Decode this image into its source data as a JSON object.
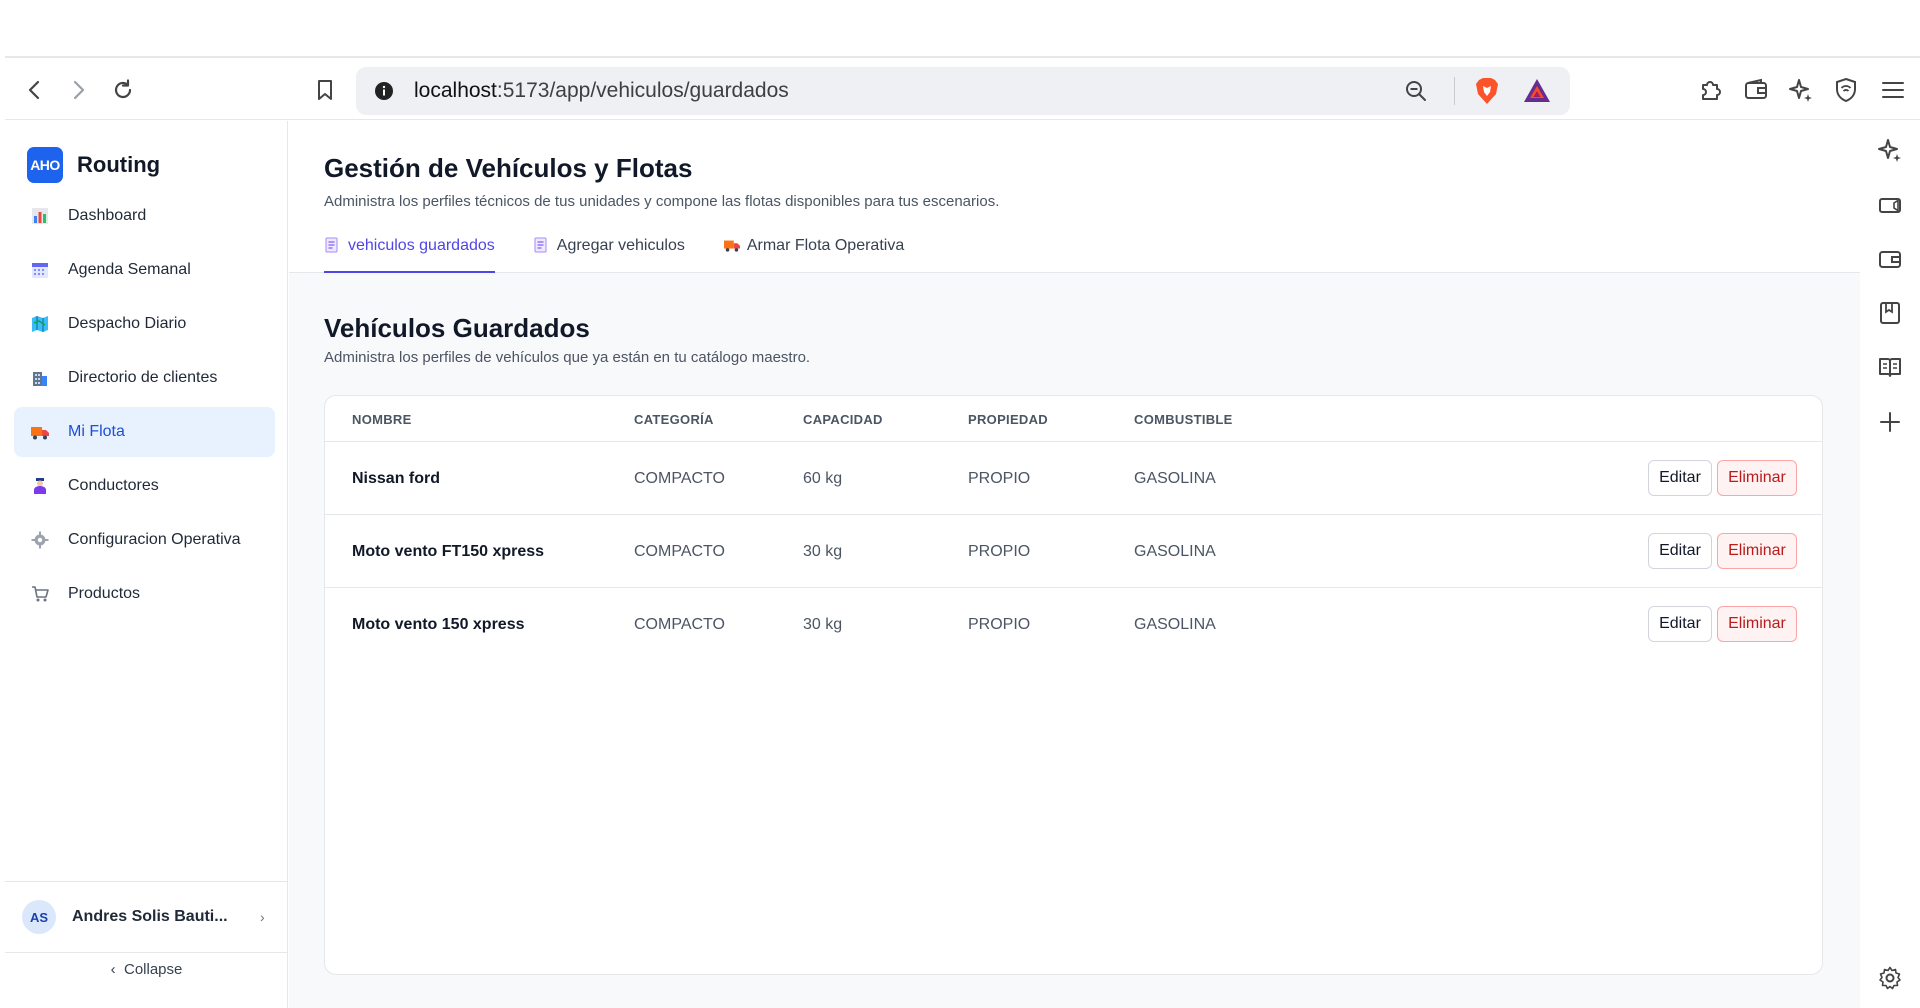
{
  "browser": {
    "url_host": "localhost",
    "url_path": ":5173/app/vehiculos/guardados"
  },
  "app": {
    "logo_mark": "AHO",
    "name": "Routing"
  },
  "sidebar": {
    "items": [
      {
        "label": "Dashboard",
        "icon": "chart-icon"
      },
      {
        "label": "Agenda Semanal",
        "icon": "calendar-icon"
      },
      {
        "label": "Despacho Diario",
        "icon": "map-icon"
      },
      {
        "label": "Directorio de clientes",
        "icon": "building-icon"
      },
      {
        "label": "Mi Flota",
        "icon": "truck-icon",
        "active": true
      },
      {
        "label": "Conductores",
        "icon": "driver-icon"
      },
      {
        "label": "Configuracion Operativa",
        "icon": "gear-icon"
      },
      {
        "label": "Productos",
        "icon": "cart-icon"
      }
    ],
    "user": {
      "initials": "AS",
      "name": "Andres Solis Bauti..."
    },
    "collapse_label": "Collapse"
  },
  "header": {
    "title": "Gestión de Vehículos y Flotas",
    "subtitle": "Administra los perfiles técnicos de tus unidades y compone las flotas disponibles para tus escenarios.",
    "tabs": [
      {
        "label": "vehiculos guardados",
        "active": true
      },
      {
        "label": "Agregar vehiculos"
      },
      {
        "label": "Armar Flota Operativa"
      }
    ]
  },
  "section": {
    "title": "Vehículos Guardados",
    "subtitle": "Administra los perfiles de vehículos que ya están en tu catálogo maestro."
  },
  "table": {
    "columns": [
      "NOMBRE",
      "CATEGORÍA",
      "CAPACIDAD",
      "PROPIEDAD",
      "COMBUSTIBLE"
    ],
    "rows": [
      {
        "nombre": "Nissan ford",
        "categoria": "COMPACTO",
        "capacidad": "60 kg",
        "propiedad": "PROPIO",
        "combustible": "GASOLINA"
      },
      {
        "nombre": "Moto vento FT150 xpress",
        "categoria": "COMPACTO",
        "capacidad": "30 kg",
        "propiedad": "PROPIO",
        "combustible": "GASOLINA"
      },
      {
        "nombre": "Moto vento 150 xpress",
        "categoria": "COMPACTO",
        "capacidad": "30 kg",
        "propiedad": "PROPIO",
        "combustible": "GASOLINA"
      }
    ],
    "edit_label": "Editar",
    "delete_label": "Eliminar"
  },
  "colors": {
    "accent": "#4f46e5",
    "brand": "#1d63ed",
    "danger": "#b91c1c"
  }
}
